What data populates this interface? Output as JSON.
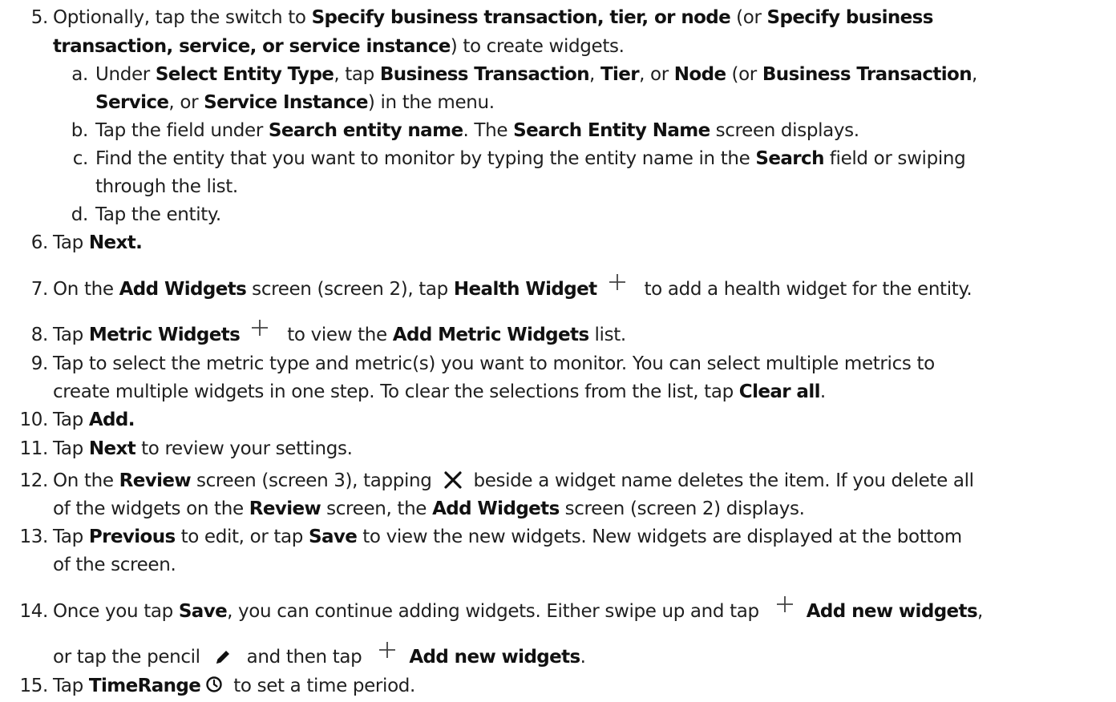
{
  "steps": {
    "s5": {
      "num": "5.",
      "p1": "Optionally, tap the switch to ",
      "b1": "Specify business transaction, tier, or node",
      "p2": " (or ",
      "b2": "Specify business",
      "b3": "transaction, service, or service instance",
      "p3": ") to create widgets."
    },
    "s5a": {
      "num": "a.",
      "p1": "Under ",
      "b1": "Select Entity Type",
      "p2": ", tap ",
      "b2": "Business Transaction",
      "p3": ", ",
      "b3": "Tier",
      "p4": ", or ",
      "b4": "Node",
      "p5": " (or ",
      "b5": "Business Transaction",
      "p6": ",",
      "b6": "Service",
      "p7": ", or ",
      "b7": "Service Instance",
      "p8": ") in the menu."
    },
    "s5b": {
      "num": "b.",
      "p1": "Tap the field under ",
      "b1": "Search entity name",
      "p2": ". The ",
      "b2": "Search Entity Name",
      "p3": " screen displays."
    },
    "s5c": {
      "num": "c.",
      "p1": "Find the entity that you want to monitor by typing the entity name in the ",
      "b1": "Search",
      "p2": " field or swiping",
      "p3": "through the list."
    },
    "s5d": {
      "num": "d.",
      "p1": "Tap the entity."
    },
    "s6": {
      "num": "6.",
      "p1": "Tap ",
      "b1": "Next."
    },
    "s7": {
      "num": "7.",
      "p1": "On the ",
      "b1": "Add Widgets",
      "p2": " screen (screen 2), tap ",
      "b2": "Health Widget",
      "p3": " to add a health widget for the entity."
    },
    "s8": {
      "num": "8.",
      "p1": "Tap ",
      "b1": "Metric Widgets",
      "p2": " to view the ",
      "b2": "Add Metric Widgets",
      "p3": " list."
    },
    "s9": {
      "num": "9.",
      "p1": "Tap to select the metric type and metric(s) you want to monitor. You can select multiple metrics to",
      "p2": "create multiple widgets in one step. To clear the selections from the list, tap ",
      "b1": "Clear all",
      "p3": "."
    },
    "s10": {
      "num": "10.",
      "p1": "Tap ",
      "b1": "Add."
    },
    "s11": {
      "num": "11.",
      "p1": "Tap ",
      "b1": "Next",
      "p2": " to review your settings."
    },
    "s12": {
      "num": "12.",
      "p1": "On the ",
      "b1": "Review",
      "p2": " screen (screen 3), tapping ",
      "p3": " beside a widget name deletes the item. If you delete all",
      "p4": "of the widgets on the ",
      "b2": "Review",
      "p5": " screen, the ",
      "b3": "Add Widgets",
      "p6": " screen (screen 2) displays."
    },
    "s13": {
      "num": "13.",
      "p1": "Tap ",
      "b1": "Previous",
      "p2": " to edit, or tap ",
      "b2": "Save",
      "p3": " to view the new widgets. New widgets are displayed at the bottom",
      "p4": "of the screen."
    },
    "s14": {
      "num": "14.",
      "p1": "Once you tap ",
      "b1": "Save",
      "p2": ", you can continue adding widgets. Either swipe up and tap ",
      "b2": "Add new widgets",
      "p3": ",",
      "p4": "or tap the pencil ",
      "p5": " and then tap ",
      "b3": "Add new widgets",
      "p6": "."
    },
    "s15": {
      "num": "15.",
      "p1": "Tap ",
      "b1": "TimeRange",
      "p2": " to set a time period."
    }
  },
  "icons": {
    "plus": "plus-icon",
    "close": "close-x-icon",
    "pencil": "pencil-icon",
    "clock": "clock-icon"
  }
}
